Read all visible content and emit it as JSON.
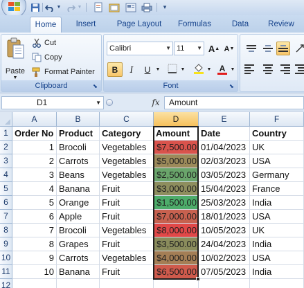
{
  "tabs": [
    "Home",
    "Insert",
    "Page Layout",
    "Formulas",
    "Data",
    "Review"
  ],
  "active_tab": "Home",
  "clipboard": {
    "paste_label": "Paste",
    "cut_label": "Cut",
    "copy_label": "Copy",
    "format_painter_label": "Format Painter",
    "group_label": "Clipboard"
  },
  "font": {
    "font_name": "Calibri",
    "font_size": "11",
    "group_label": "Font",
    "bold": "B",
    "italic": "I",
    "underline": "U",
    "grow": "A",
    "shrink": "A",
    "color_letter": "A"
  },
  "formula_bar": {
    "name_box": "D1",
    "fx": "fx",
    "content": "Amount"
  },
  "columns": [
    "A",
    "B",
    "C",
    "D",
    "E",
    "F"
  ],
  "selected_column": "D",
  "rows": [
    "1",
    "2",
    "3",
    "4",
    "5",
    "6",
    "7",
    "8",
    "9",
    "10",
    "11",
    "12"
  ],
  "table": {
    "headers": [
      "Order No",
      "Product",
      "Category",
      "Amount",
      "Date",
      "Country"
    ],
    "records": [
      {
        "order": "1",
        "product": "Brocoli",
        "category": "Vegetables",
        "amount": "$7,500.00",
        "date": "01/04/2023",
        "country": "UK"
      },
      {
        "order": "2",
        "product": "Carrots",
        "category": "Vegetables",
        "amount": "$5,000.00",
        "date": "02/03/2023",
        "country": "USA"
      },
      {
        "order": "3",
        "product": "Beans",
        "category": "Vegetables",
        "amount": "$2,500.00",
        "date": "03/05/2023",
        "country": "Germany"
      },
      {
        "order": "4",
        "product": "Banana",
        "category": "Fruit",
        "amount": "$3,000.00",
        "date": "15/04/2023",
        "country": "France"
      },
      {
        "order": "5",
        "product": "Orange",
        "category": "Fruit",
        "amount": "$1,500.00",
        "date": "25/03/2023",
        "country": "India"
      },
      {
        "order": "6",
        "product": "Apple",
        "category": "Fruit",
        "amount": "$7,000.00",
        "date": "18/01/2023",
        "country": "USA"
      },
      {
        "order": "7",
        "product": "Brocoli",
        "category": "Vegetables",
        "amount": "$8,000.00",
        "date": "10/05/2023",
        "country": "UK"
      },
      {
        "order": "8",
        "product": "Grapes",
        "category": "Fruit",
        "amount": "$3,500.00",
        "date": "24/04/2023",
        "country": "India"
      },
      {
        "order": "9",
        "product": "Carrots",
        "category": "Vegetables",
        "amount": "$4,000.00",
        "date": "10/02/2023",
        "country": "USA"
      },
      {
        "order": "10",
        "product": "Banana",
        "category": "Fruit",
        "amount": "$6,500.00",
        "date": "07/05/2023",
        "country": "India"
      }
    ]
  },
  "amount_colors": [
    "#d9534c",
    "#9c8a5a",
    "#6aa56b",
    "#8e8e5e",
    "#4dac6a",
    "#c7614f",
    "#e14848",
    "#8a8c5c",
    "#a47e55",
    "#cf5a4c"
  ],
  "colors": {
    "selection": "#1e1e1e",
    "ribbon_text": "#15428b",
    "header_selected": "#f6c15c"
  }
}
